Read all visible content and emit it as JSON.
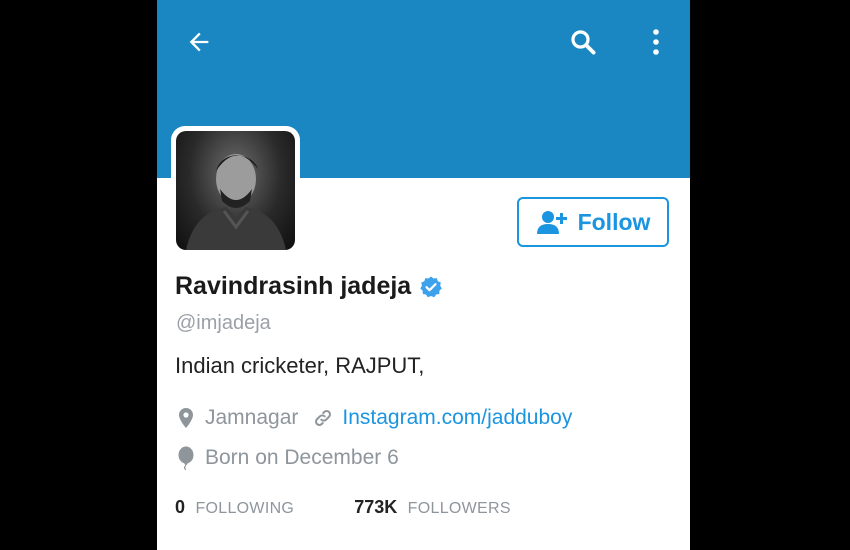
{
  "profile": {
    "name": "Ravindrasinh jadeja",
    "handle": "@imjadeja",
    "bio": "Indian cricketer, RAJPUT,",
    "location": "Jamnagar",
    "link": "Instagram.com/jadduboy",
    "birthday": "Born on December 6",
    "verified": true
  },
  "actions": {
    "follow_label": "Follow"
  },
  "stats": {
    "following_count": "0",
    "following_label": "FOLLOWING",
    "followers_count": "773K",
    "followers_label": "FOLLOWERS"
  },
  "colors": {
    "header_bg": "#1a87c3",
    "accent": "#1b95e0",
    "muted_text": "#8e969c"
  },
  "icons": {
    "back": "arrow-left-icon",
    "search": "search-icon",
    "more": "more-vertical-icon",
    "verified": "verified-badge-icon",
    "location": "location-pin-icon",
    "link": "link-icon",
    "birthday": "balloon-icon",
    "follow": "add-user-icon"
  }
}
